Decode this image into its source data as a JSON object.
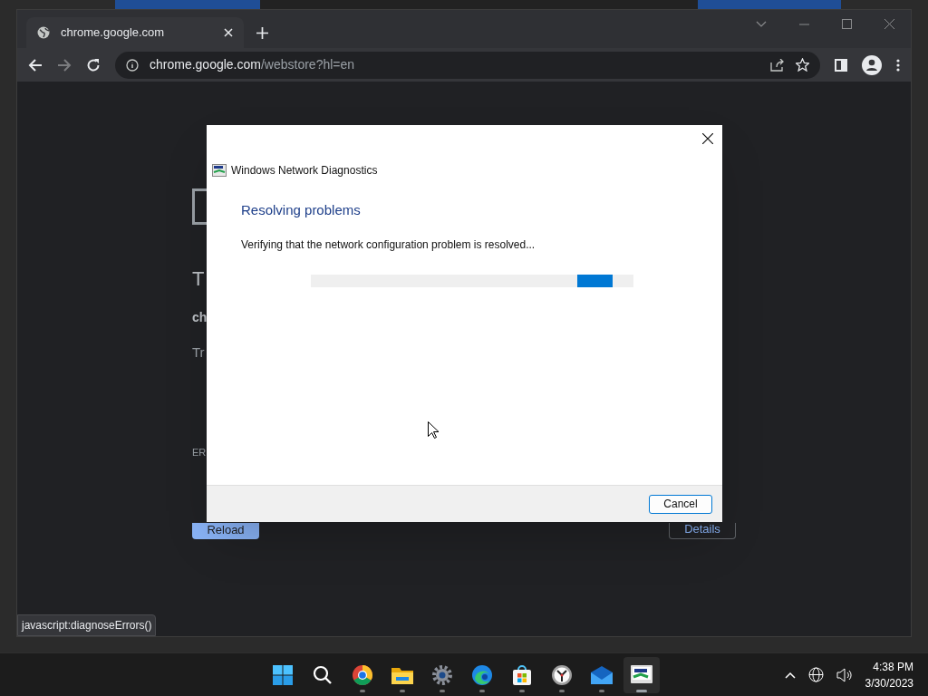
{
  "browser": {
    "tab": {
      "title": "chrome.google.com",
      "selected": true
    },
    "address": {
      "host": "chrome.google.com",
      "path": "/webstore?hl=en"
    },
    "page": {
      "fragments": [
        "T",
        "ch",
        "Tr",
        "ER"
      ],
      "buttons": [
        {
          "label": "Reload",
          "kind": "primary"
        },
        {
          "label": "Details",
          "kind": "outline"
        }
      ]
    },
    "status_bubble": "javascript:diagnoseErrors()"
  },
  "dialog": {
    "title": "Windows Network Diagnostics",
    "heading": "Resolving problems",
    "message": "Verifying that the network configuration problem is resolved...",
    "progress": {
      "kind": "indeterminate"
    },
    "buttons": [
      "Cancel"
    ]
  },
  "taskbar": {
    "apps": [
      {
        "kind": "start",
        "active": false
      },
      {
        "kind": "search",
        "active": false
      },
      {
        "kind": "chrome",
        "active": false
      },
      {
        "kind": "folder",
        "active": false
      },
      {
        "kind": "gear",
        "active": false
      },
      {
        "kind": "edge",
        "active": false
      },
      {
        "kind": "store",
        "active": false
      },
      {
        "kind": "clock",
        "active": false
      },
      {
        "kind": "mail",
        "active": false
      },
      {
        "kind": "diagnostics",
        "active": true
      }
    ],
    "time": "4:38 PM",
    "date": "3/30/2023"
  }
}
